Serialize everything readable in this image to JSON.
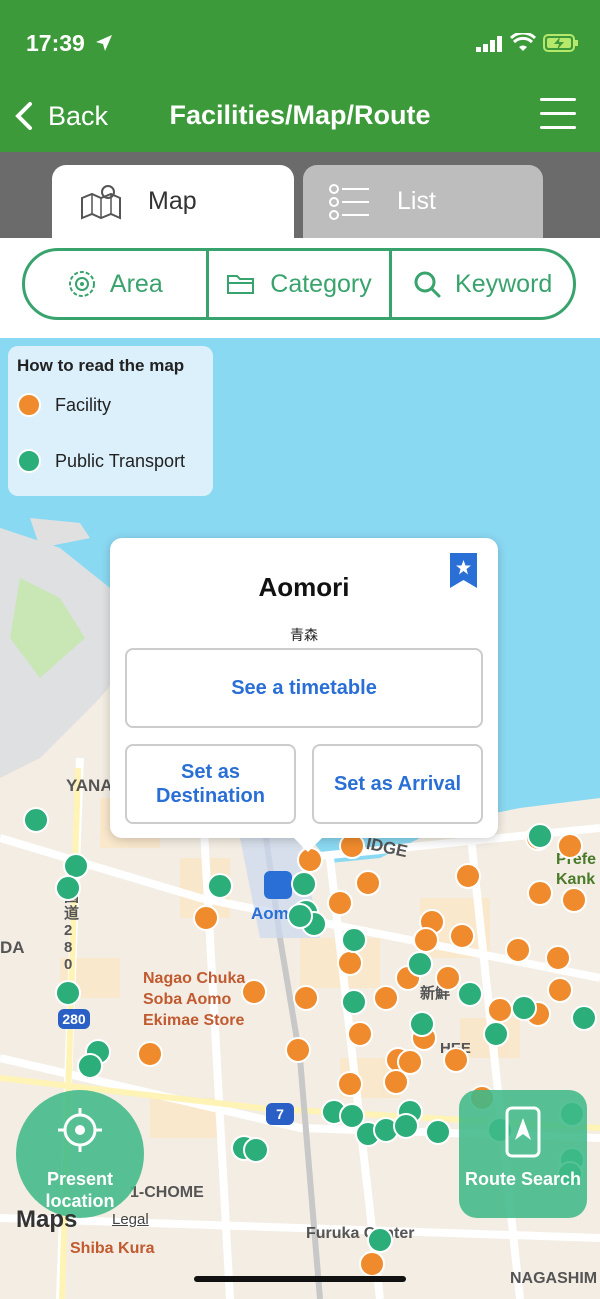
{
  "status_bar": {
    "time": "17:39"
  },
  "nav": {
    "back_label": "Back",
    "title": "Facilities/Map/Route"
  },
  "tabs": [
    {
      "label": "Map",
      "active": true
    },
    {
      "label": "List",
      "active": false
    }
  ],
  "filters": {
    "area": "Area",
    "category": "Category",
    "keyword": "Keyword"
  },
  "legend": {
    "title": "How to read the map",
    "items": [
      {
        "label": "Facility",
        "color": "#ef8b2c"
      },
      {
        "label": "Public Transport",
        "color": "#2bae7a"
      }
    ]
  },
  "popup": {
    "title": "Aomori",
    "subtitle": "青森",
    "timetable_button": "See a timetable",
    "destination_button": "Set as Destination",
    "arrival_button": "Set as Arrival"
  },
  "map_labels": {
    "station": "Aom",
    "yana": "YANA",
    "bridge": "IDGE",
    "da": "DA",
    "route_vertical": "国道280",
    "route_280": "280",
    "route_7": "7",
    "nagao": "Nagao Chuka Soba Aomo Ekimae Store",
    "chome": "1-CHOME",
    "shiba": "Shiba Kura",
    "furukawa": "Furuka  Center",
    "nagashi": "NAGASHIM",
    "prefecture": "Prefe Kank",
    "shinmachi": "新鮮",
    "hee": "HEE"
  },
  "present_location": {
    "label": "Present location"
  },
  "route_search": {
    "label": "Route Search"
  },
  "maps_attribution": {
    "logo": "Maps",
    "legal": "Legal"
  },
  "colors": {
    "header": "#3d9a3a",
    "accent": "#39a36d",
    "facility": "#ef8b2c",
    "transport": "#2bae7a",
    "link": "#2a6fd6"
  }
}
